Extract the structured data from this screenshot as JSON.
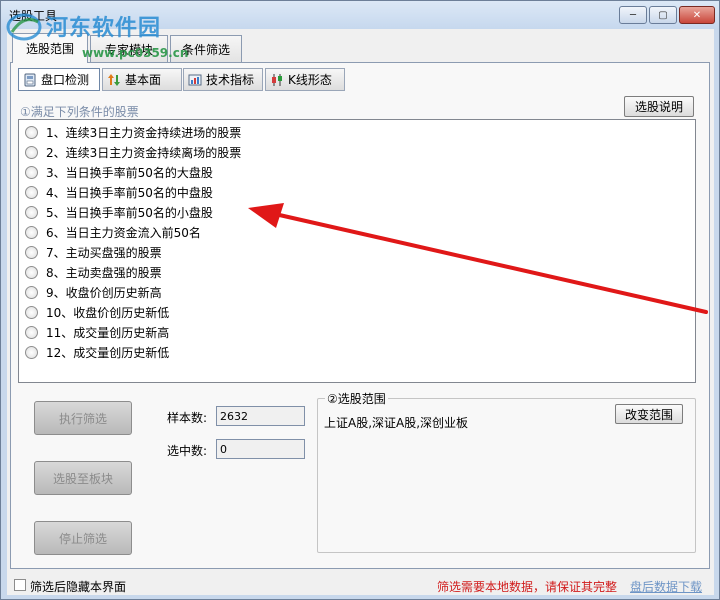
{
  "window": {
    "title": "选股工具",
    "controls": {
      "minimize": "─",
      "maximize": "▢",
      "close": "✕"
    }
  },
  "watermark": {
    "site_name": "河东软件园",
    "url": "www.pc0359.cn"
  },
  "main_tabs": [
    {
      "label": "选股范围"
    },
    {
      "label": "专家模块"
    },
    {
      "label": "条件筛选"
    }
  ],
  "sub_tabs": [
    {
      "label": "盘口检测",
      "icon": "disk-icon"
    },
    {
      "label": "基本面",
      "icon": "updown-arrows-icon"
    },
    {
      "label": "技术指标",
      "icon": "indicator-icon"
    },
    {
      "label": "K线形态",
      "icon": "candlestick-icon"
    }
  ],
  "conditions": {
    "heading": "①满足下列条件的股票",
    "explain_button": "选股说明",
    "items": [
      "1、连续3日主力资金持续进场的股票",
      "2、连续3日主力资金持续离场的股票",
      "3、当日换手率前50名的大盘股",
      "4、当日换手率前50名的中盘股",
      "5、当日换手率前50名的小盘股",
      "6、当日主力资金流入前50名",
      "7、主动买盘强的股票",
      "8、主动卖盘强的股票",
      "9、收盘价创历史新高",
      "10、收盘价创历史新低",
      "11、成交量创历史新高",
      "12、成交量创历史新低"
    ]
  },
  "actions": {
    "execute": "执行筛选",
    "to_block": "选股至板块",
    "stop": "停止筛选"
  },
  "stats": {
    "sample_label": "样本数:",
    "sample_value": "2632",
    "selected_label": "选中数:",
    "selected_value": "0"
  },
  "range": {
    "legend": "②选股范围",
    "value": "上证A股,深证A股,深创业板",
    "change_button": "改变范围"
  },
  "footer": {
    "hide_label": "筛选后隐藏本界面",
    "warning": "筛选需要本地数据，请保证其完整",
    "download_link": "盘后数据下载"
  },
  "colors": {
    "arrow": "#e01818",
    "warning": "#d11c1c",
    "link": "#6e95c6"
  }
}
